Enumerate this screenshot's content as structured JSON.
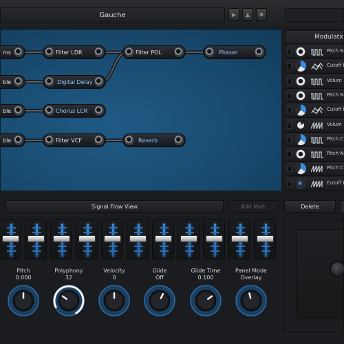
{
  "header": {
    "preset_name": "Gauche",
    "buttons": [
      "play-icon",
      "upload-icon",
      "settings-icon"
    ]
  },
  "graph": {
    "nodes": [
      {
        "id": "n1",
        "label": "ms",
        "style": "normal"
      },
      {
        "id": "n2",
        "label": "Filter LDR",
        "style": "normal"
      },
      {
        "id": "n3",
        "label": "Filter POL",
        "style": "normal"
      },
      {
        "id": "n4",
        "label": "Phaser",
        "style": "blue"
      },
      {
        "id": "n5",
        "label": "ble",
        "style": "normal"
      },
      {
        "id": "n6",
        "label": "Digital Delay",
        "style": "blue"
      },
      {
        "id": "n7",
        "label": "ble",
        "style": "normal"
      },
      {
        "id": "n8",
        "label": "Chorus LCR",
        "style": "blue"
      },
      {
        "id": "n9",
        "label": "ble",
        "style": "normal"
      },
      {
        "id": "n10",
        "label": "Filter VCF",
        "style": "normal"
      },
      {
        "id": "n11",
        "label": "Reverb",
        "style": "blue"
      }
    ]
  },
  "modulation": {
    "title": "Modulation",
    "rows": [
      {
        "target": "Pitch N",
        "source": "ring",
        "wave": "square"
      },
      {
        "target": "Cutoff I",
        "source": "half",
        "wave": "noise"
      },
      {
        "target": "Volum",
        "source": "ring",
        "wave": "square"
      },
      {
        "target": "Pitch N",
        "source": "ring",
        "wave": "square"
      },
      {
        "target": "Cutoff I",
        "source": "half",
        "wave": "noise"
      },
      {
        "target": "Volum",
        "source": "ring-open",
        "wave": "saw"
      },
      {
        "target": "Pitch C",
        "source": "half",
        "wave": "square"
      },
      {
        "target": "Pitch N",
        "source": "ring",
        "wave": "square"
      },
      {
        "target": "Pitch C",
        "source": "half",
        "wave": "saw"
      },
      {
        "target": "Cutoff I",
        "source": "dot",
        "wave": "saw"
      }
    ]
  },
  "controls": {
    "signal_flow_label": "Signal Flow View",
    "add_mod_label": "Add Mod",
    "delete_label": "Delete"
  },
  "faders": {
    "count": 11
  },
  "knobs": [
    {
      "label": "Pitch",
      "value": "0.000",
      "level": 0.5,
      "ring": false
    },
    {
      "label": "Polyphony",
      "value": "32",
      "level": 0.3,
      "ring": true
    },
    {
      "label": "Velocity",
      "value": "0",
      "level": 0.5,
      "ring": false
    },
    {
      "label": "Glide",
      "value": "Off",
      "level": 0.6,
      "ring": false
    },
    {
      "label": "Glide Time",
      "value": "0.100",
      "level": 0.7,
      "ring": false
    },
    {
      "label": "Panel Mode",
      "value": "Overlay",
      "level": 0.45,
      "ring": false
    }
  ],
  "colors": {
    "accent": "#3a8ee0",
    "graph_bg": "#1b527b",
    "node_text_blue": "#8fc6ff"
  }
}
